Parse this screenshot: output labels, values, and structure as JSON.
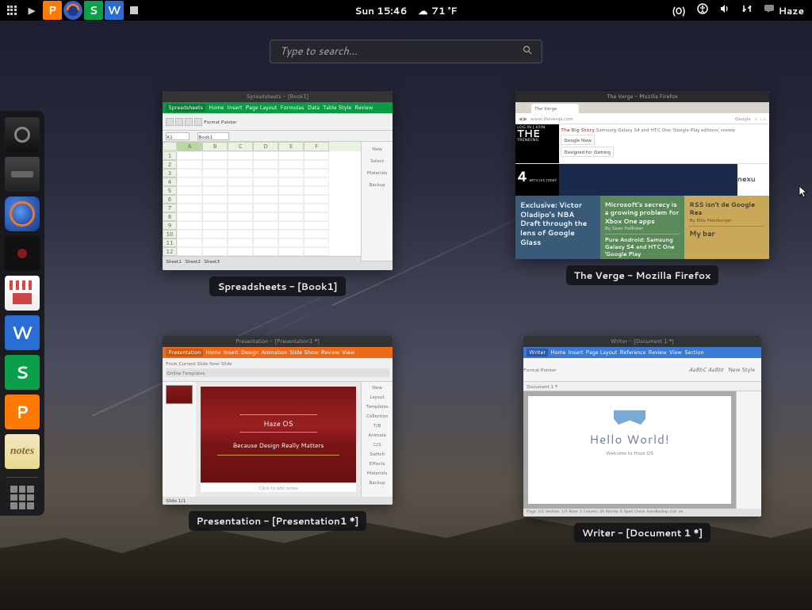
{
  "panel": {
    "clock": "Sun 15:46",
    "weather_icon": "☁",
    "weather_temp": "71 °F",
    "notify_count": "(0)",
    "user_label": "Haze"
  },
  "search": {
    "placeholder": "Type to search..."
  },
  "dash": {
    "items": [
      {
        "name": "camera",
        "letter": ""
      },
      {
        "name": "scanner",
        "letter": ""
      },
      {
        "name": "firefox",
        "letter": ""
      },
      {
        "name": "record",
        "letter": ""
      },
      {
        "name": "shop",
        "letter": ""
      },
      {
        "name": "writer",
        "letter": "W"
      },
      {
        "name": "sheets",
        "letter": "S"
      },
      {
        "name": "present",
        "letter": "P"
      },
      {
        "name": "notes",
        "letter": "notes"
      }
    ]
  },
  "windows": [
    {
      "label": "Spreadsheets - [Book1]",
      "type": "spreadsheet",
      "titlebar": "Spreadsheets - [Book1]",
      "menubar": [
        "Spreadsheets",
        "Home",
        "Insert",
        "Page Layout",
        "Formulas",
        "Data",
        "Table Style",
        "Review"
      ],
      "cellref": "A1",
      "tabname": "Book1",
      "columns": [
        "A",
        "B",
        "C",
        "D",
        "E",
        "F"
      ],
      "rows": [
        "1",
        "2",
        "3",
        "4",
        "5",
        "6",
        "7",
        "8",
        "9",
        "10",
        "11",
        "12"
      ],
      "side": [
        "New",
        "Select",
        "Materials",
        "Backup"
      ],
      "sheets": [
        "Sheet1",
        "Sheet2",
        "Sheet3"
      ],
      "toolbarlabel": "Format Painter"
    },
    {
      "label": "The Verge - Mozilla Firefox",
      "type": "firefox",
      "titlebar": "The Verge - Mozilla Firefox",
      "tab": "The Verge",
      "url": "www.theverge.com",
      "searchengine": "Google",
      "logo": "THE",
      "login": "LOG IN | JOIN",
      "bigstory": "The Big Story",
      "headline": "Samsung Galaxy S4 and HTC One 'Google Play editions' review",
      "nav1": "Google Now",
      "nav2": "Designed for Gaming",
      "sidebar_num": "4",
      "sidebar_sub": "ARTICLES\nTODAY",
      "trending": "TRENDING",
      "nexus": "nexu",
      "cards": [
        {
          "title": "Exclusive: Victor Oladipo's NBA Draft through the lens of Google Glass",
          "sub": ""
        },
        {
          "title": "Microsoft's secrecy is a growing problem for Xbox One apps",
          "sub": "By Sean Hollister"
        },
        {
          "title": "RSS isn't de\nGoogle Rea",
          "sub": "By Ellis Hamburger"
        },
        {
          "title": "Pure Android: Samsung Galaxy S4 and HTC One 'Google Play",
          "sub": ""
        },
        {
          "title": "My bar",
          "sub": ""
        }
      ]
    },
    {
      "label": "Presentation - [Presentation1 *]",
      "type": "presentation",
      "titlebar": "Presentation - [Presentation1 *]",
      "menubar": [
        "Presentation",
        "Home",
        "Insert",
        "Design",
        "Animation",
        "Slide Show",
        "Review",
        "View"
      ],
      "toolbar": "From Current Slide    New Slide",
      "templates": "Online Templates",
      "slide_title": "Haze OS",
      "slide_sub": "Because Design Really Matters",
      "notes": "Click to add notes",
      "side": [
        "New",
        "Layout",
        "Templates",
        "Collection",
        "T/B",
        "Animate",
        "C/S",
        "Switch",
        "Effects",
        "Materials",
        "Backup"
      ],
      "status": "Slide 1/1"
    },
    {
      "label": "Writer - [Document 1 *]",
      "type": "writer",
      "titlebar": "Writer - [Document 1 *]",
      "menubar": [
        "Writer",
        "Home",
        "Insert",
        "Page Layout",
        "Reference",
        "Review",
        "View",
        "Section"
      ],
      "styles": "AaBbC AaBbt",
      "newstyle": "New Style",
      "formatpainter": "Format Painter",
      "doctab": "Document 1 *",
      "hello": "Hello World!",
      "welcome": "Welcome to Haze OS",
      "status": "Page: 1/1 Section: 1/1  Row: 3 Column: 20  Words: 6  Spell Check  AutoBackup  List: on"
    }
  ]
}
